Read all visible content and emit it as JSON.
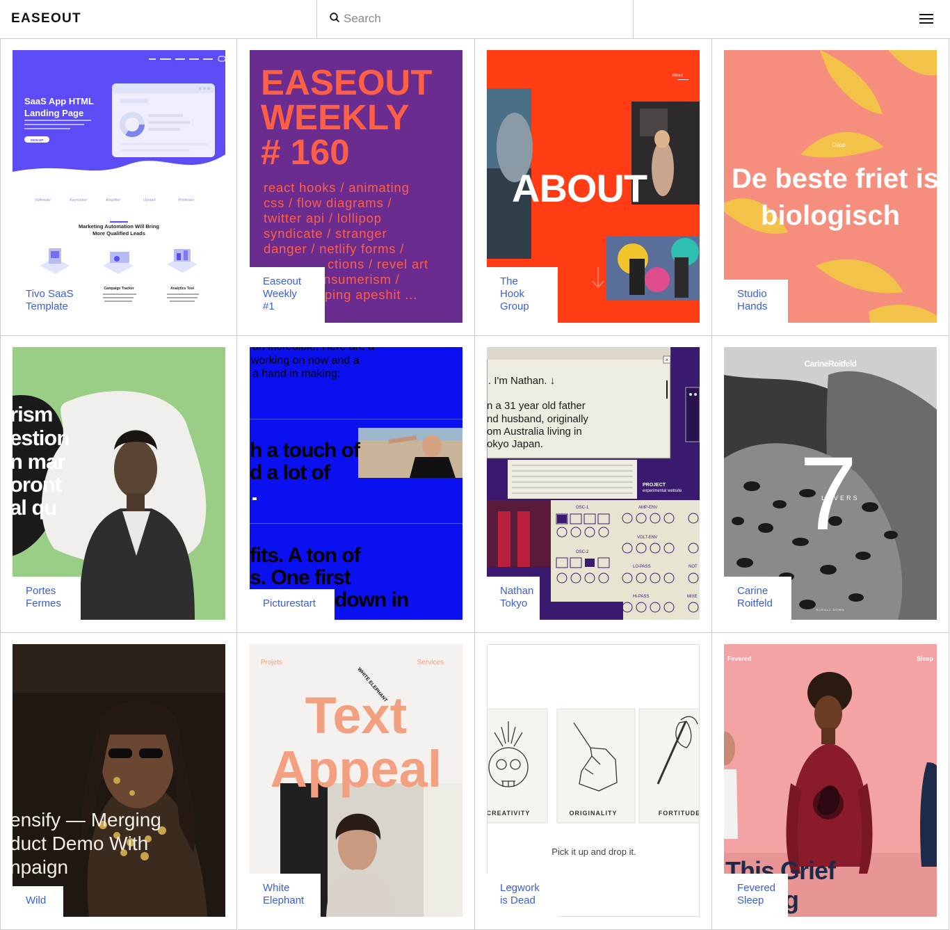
{
  "header": {
    "logo": "EASEOUT",
    "search_placeholder": "Search"
  },
  "cards": [
    {
      "title_lines": [
        "Tivo SaaS",
        "Template"
      ],
      "thumb_text": {
        "headline": "SaaS App HTML Landing Page",
        "button": "SIGN UP",
        "section": "Marketing Automation Will Bring More Qualified Leads",
        "logos": [
          "Vollmeter",
          "Keyrunner",
          "Amplifier",
          "Upstart",
          "Primester"
        ],
        "features": [
          "Campaign Tracker",
          "Analytics Tool"
        ]
      }
    },
    {
      "title_lines": [
        "Easeout",
        "Weekly",
        "#1"
      ],
      "thumb_text": {
        "headline": [
          "EASEOUT",
          "WEEKLY",
          "# 160"
        ],
        "topics": [
          "react hooks / animating",
          "css / flow diagrams /",
          "twitter api / lollipop",
          "syndicate / stranger",
          "danger / netlify forms /",
          "ctions / revel art",
          "nsumerism /",
          "ping apeshit ..."
        ]
      }
    },
    {
      "title_lines": [
        "The",
        "Hook",
        "Group"
      ],
      "thumb_text": {
        "headline": "ABOUT",
        "nav": "About"
      }
    },
    {
      "title_lines": [
        "Studio",
        "Hands"
      ],
      "thumb_text": {
        "headline": [
          "De beste friet is",
          "biologisch"
        ],
        "nav": "Dapp"
      }
    },
    {
      "title_lines": [
        "Portes",
        "Fermes"
      ],
      "thumb_text": {
        "words": [
          "rism",
          "estion",
          "n mar",
          "oront",
          "al qu"
        ]
      }
    },
    {
      "title_lines": [
        "Picturestart"
      ],
      "thumb_text": {
        "lines": [
          "working on now and a",
          "a hand in making:",
          "h a touch of",
          "d a lot of",
          "fits. A ton of",
          "s. One first",
          "down in"
        ]
      }
    },
    {
      "title_lines": [
        "Nathan",
        "Tokyo"
      ],
      "thumb_text": {
        "lines": [
          ". I'm Nathan. ↓",
          "n a 31 year old father",
          "nd husband, originally",
          "om Australia living in",
          "okyo Japan."
        ],
        "project": "PROJECT",
        "project_sub": "experimental website",
        "synth": [
          "OSC-1",
          "AMP-ENV",
          "VOLT-ENV",
          "OSC-2",
          "LO-PASS",
          "HI-PASS",
          "NOT",
          "MIXE"
        ]
      }
    },
    {
      "title_lines": [
        "Carine",
        "Roitfeld"
      ],
      "thumb_text": {
        "brand": "CarineRoitfeld",
        "number": "7",
        "sub": "LOVERS",
        "scroll": "SCROLL DOWN"
      }
    },
    {
      "title_lines": [
        "Wild"
      ],
      "thumb_text": {
        "lines": [
          "ensify — Merging",
          "duct Demo With",
          "npaign"
        ]
      }
    },
    {
      "title_lines": [
        "White",
        "Elephant"
      ],
      "thumb_text": {
        "nav_left": "Projets",
        "nav_right": "Services",
        "headline": [
          "Text",
          "Appeal"
        ],
        "badge": "WHITE ELEPHANT"
      }
    },
    {
      "title_lines": [
        "Legwork",
        "is Dead"
      ],
      "thumb_text": {
        "cards": [
          "CREATIVITY",
          "ORIGINALITY",
          "FORTITUDE"
        ],
        "caption": "Pick it up and drop it."
      }
    },
    {
      "title_lines": [
        "Fevered",
        "Sleep"
      ],
      "thumb_text": {
        "nav_left": "Fevered",
        "nav_right": "Sleep",
        "headline": [
          "This Grief",
          "g"
        ]
      }
    }
  ],
  "colors": {
    "link": "#3a5ed6",
    "tivo": "#5b4cf5",
    "easeout_purple": "#6a2c8e",
    "easeout_orange": "#ff5f45",
    "hook_red": "#ff3c14",
    "studio_pink": "#f58e7c",
    "studio_yellow": "#f2c249",
    "portes_green": "#9acd86",
    "picturestart_blue": "#0b10f0",
    "nathan_purple": "#3a1a6e",
    "white_elephant_peach": "#f2a07f",
    "fevered_pink": "#f3a3a4",
    "fevered_sweater": "#8a1b2b"
  }
}
